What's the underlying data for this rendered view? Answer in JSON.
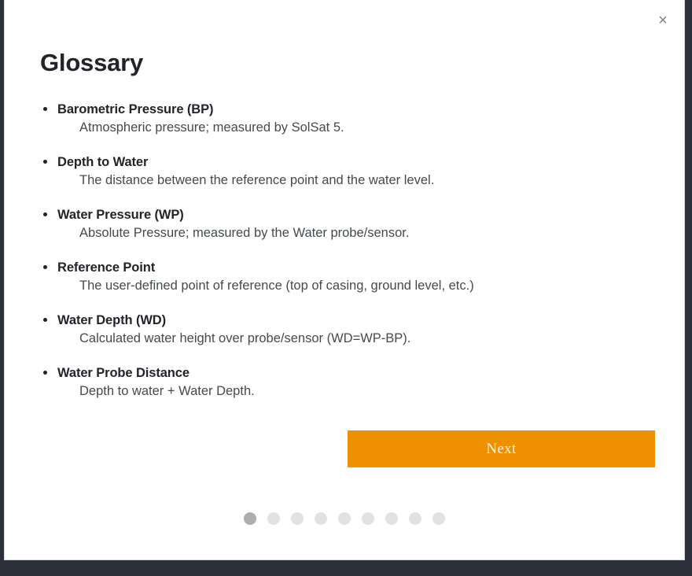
{
  "modal": {
    "title": "Glossary",
    "close_label": "×",
    "close_icon": "close-icon"
  },
  "glossary": {
    "items": [
      {
        "term": "Barometric Pressure (BP)",
        "definition": "Atmospheric pressure; measured by SolSat 5."
      },
      {
        "term": "Depth to Water",
        "definition": "The distance between the reference point and the water level."
      },
      {
        "term": "Water Pressure (WP)",
        "definition": "Absolute Pressure; measured by the Water probe/sensor."
      },
      {
        "term": "Reference Point",
        "definition": "The user-defined point of reference (top of casing, ground level, etc.)"
      },
      {
        "term": "Water Depth (WD)",
        "definition": "Calculated water height over probe/sensor (WD=WP-BP)."
      },
      {
        "term": "Water Probe Distance",
        "definition": "Depth to water + Water Depth."
      }
    ]
  },
  "footer": {
    "next_label": "Next",
    "pager": {
      "total": 9,
      "active_index": 0
    }
  },
  "colors": {
    "accent": "#ee9000",
    "next_text": "#fdf6e6",
    "title": "#212529",
    "definition_text": "#444a4e",
    "dot_active": "#adadad",
    "dot_inactive": "#e2e2e2",
    "backdrop": "#2c303a",
    "modal_bg": "#ffffff"
  }
}
